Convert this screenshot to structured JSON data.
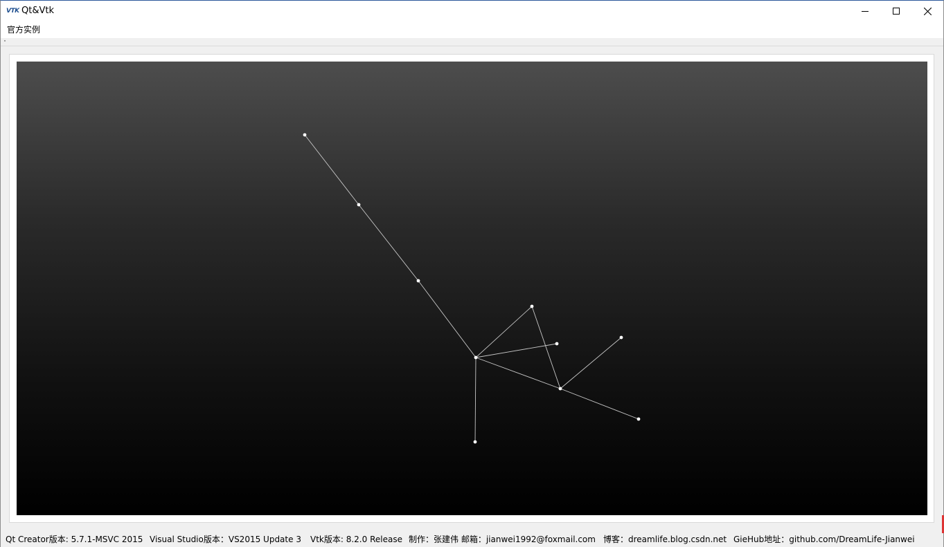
{
  "window": {
    "title": "Qt&Vtk",
    "icon_text": "VTK",
    "icon": "vtk-logo-icon",
    "controls": [
      "minimize-icon",
      "maximize-icon",
      "close-icon"
    ]
  },
  "menubar": {
    "items": [
      {
        "label": "官方实例"
      }
    ]
  },
  "render_view": {
    "background_top": "#4d4d4d",
    "background_bottom": "#000000",
    "line_color": "#c8c8c8",
    "point_color": "#ffffff"
  },
  "statusbar": {
    "items": [
      {
        "label": "Qt Creator版本: 5.7.1-MSVC 2015"
      },
      {
        "label": "Visual Studio版本：VS2015 Update 3"
      },
      {
        "label": "Vtk版本: 8.2.0 Release"
      },
      {
        "label": "制作：张建伟  邮箱：jianwei1992@foxmail.com"
      },
      {
        "label": "博客：dreamlife.blog.csdn.net"
      },
      {
        "label": "GieHub地址：github.com/DreamLife-Jianwei"
      }
    ]
  }
}
